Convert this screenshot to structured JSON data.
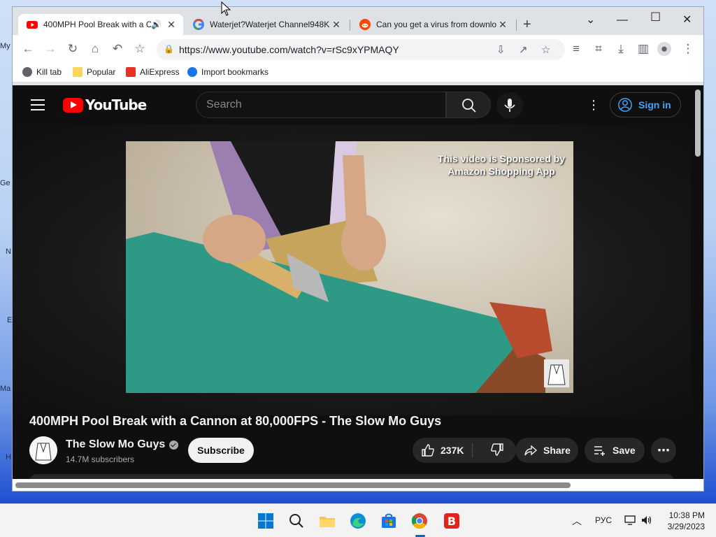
{
  "desktop": {
    "labels": [
      "My",
      "Ge",
      "N",
      "E",
      "Ma",
      "H"
    ]
  },
  "tabs": [
    {
      "title": "400MPH Pool Break with a C",
      "favicon": "youtube-icon",
      "active": true
    },
    {
      "title": "Waterjet?Waterjet Channel948K",
      "favicon": "google-icon",
      "active": false
    },
    {
      "title": "Can you get a virus from downlo",
      "favicon": "reddit-icon",
      "active": false
    }
  ],
  "toolbar": {
    "url": "https://www.youtube.com/watch?v=rSc9xYPMAQY"
  },
  "bookmarks": [
    {
      "label": "Kill tab",
      "icon": "globe-icon"
    },
    {
      "label": "Popular",
      "icon": "folder-icon"
    },
    {
      "label": "AliExpress",
      "icon": "aliexpress-icon"
    },
    {
      "label": "Import bookmarks",
      "icon": "gear-icon"
    }
  ],
  "youtube": {
    "logo_text": "YouTube",
    "search_placeholder": "Search",
    "sign_in": "Sign in",
    "sponsor_text_line1": "This video is Sponsored by",
    "sponsor_text_line2": "Amazon Shopping App",
    "video_title": "400MPH Pool Break with a Cannon at 80,000FPS - The Slow Mo Guys",
    "channel_name": "The Slow Mo Guys",
    "subscribers": "14.7M subscribers",
    "subscribe": "Subscribe",
    "likes": "237K",
    "share": "Share",
    "save": "Save"
  },
  "taskbar": {
    "language": "РУС",
    "time": "10:38 PM",
    "date": "3/29/2023"
  },
  "colors": {
    "youtube_red": "#ff0000",
    "link_blue": "#3ea6ff",
    "yt_background": "#0f0f0f",
    "felt_green": "#2e9a86"
  }
}
